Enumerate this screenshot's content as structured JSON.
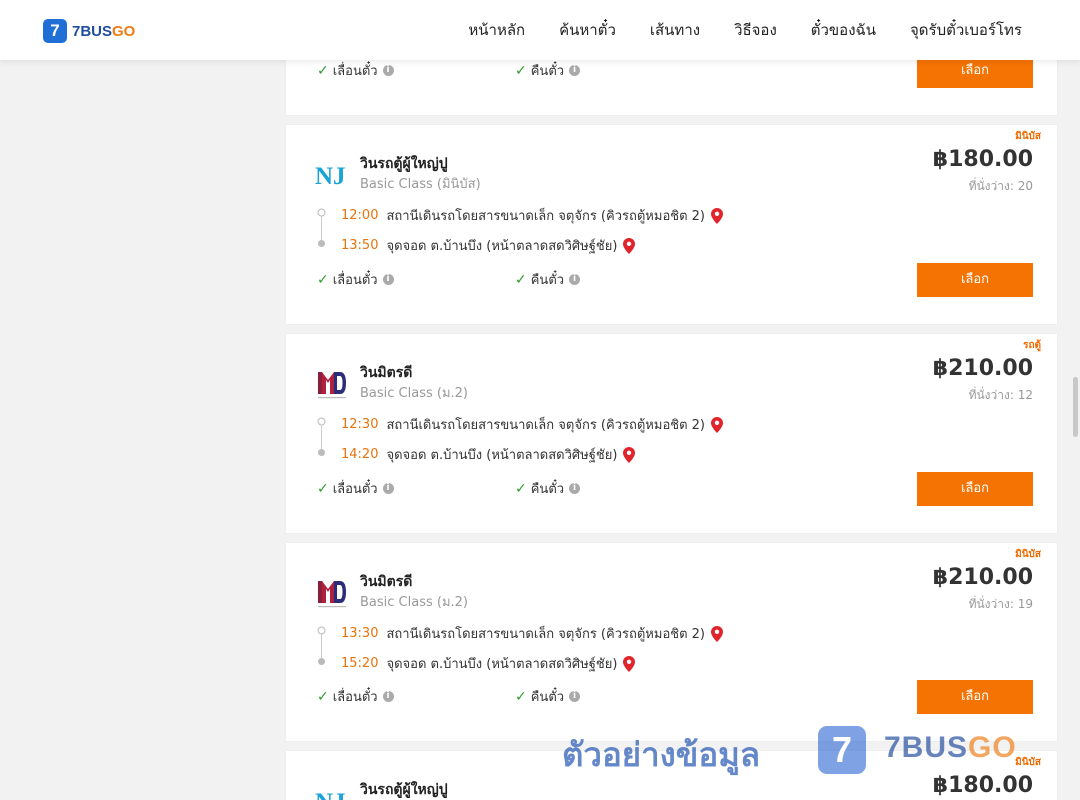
{
  "header": {
    "brand_7": "7",
    "brand_bus": "7BUS",
    "brand_go": "GO",
    "nav": [
      "หน้าหลัก",
      "ค้นหาตั๋ว",
      "เส้นทาง",
      "วิธีจอง",
      "ตั๋วของฉัน",
      "จุดรับตั๋วเบอร์โทร"
    ]
  },
  "common": {
    "select_label": "เลือก",
    "change_seat": "เลื่อนตั๋ว",
    "refund": "คืนตั๋ว",
    "info": "i",
    "check": "✓"
  },
  "cards": [
    {
      "type": "มินิบัส",
      "operator": "วินรถตู้ผู้ใหญ่ปู",
      "logo": "NJ",
      "class": "Basic Class (มินิบัส)",
      "price": "฿180.00",
      "seats": "ที่นั่งว่าง: 20",
      "depart_time": "12:00",
      "depart_place": "สถานีเดินรถโดยสารขนาดเล็ก จตุจักร (คิวรถตู้หมอชิต 2)",
      "arrive_time": "13:50",
      "arrive_place": "จุดจอด ต.บ้านบึง (หน้าตลาดสดวิศิษฐ์ชัย)"
    },
    {
      "type": "รถตู้",
      "operator": "วินมิตรดี",
      "logo": "MD",
      "class": "Basic Class (ม.2)",
      "price": "฿210.00",
      "seats": "ที่นั่งว่าง: 12",
      "depart_time": "12:30",
      "depart_place": "สถานีเดินรถโดยสารขนาดเล็ก จตุจักร (คิวรถตู้หมอชิต 2)",
      "arrive_time": "14:20",
      "arrive_place": "จุดจอด ต.บ้านบึง (หน้าตลาดสดวิศิษฐ์ชัย)"
    },
    {
      "type": "มินิบัส",
      "operator": "วินมิตรดี",
      "logo": "MD",
      "class": "Basic Class (ม.2)",
      "price": "฿210.00",
      "seats": "ที่นั่งว่าง: 19",
      "depart_time": "13:30",
      "depart_place": "สถานีเดินรถโดยสารขนาดเล็ก จตุจักร (คิวรถตู้หมอชิต 2)",
      "arrive_time": "15:20",
      "arrive_place": "จุดจอด ต.บ้านบึง (หน้าตลาดสดวิศิษฐ์ชัย)"
    },
    {
      "type": "มินิบัส",
      "operator": "วินรถตู้ผู้ใหญ่ปู",
      "logo": "NJ",
      "price": "฿180.00"
    }
  ],
  "watermark": {
    "text": "ตัวอย่างข้อมูล",
    "logo": "7",
    "brand_bus": "7BUS",
    "brand_go": "GO"
  },
  "colors": {
    "accent": "#f57303",
    "brand_blue": "#1f6fd6",
    "time": "#e8730c",
    "check": "#2e9b2e",
    "pin": "#e0242b"
  }
}
